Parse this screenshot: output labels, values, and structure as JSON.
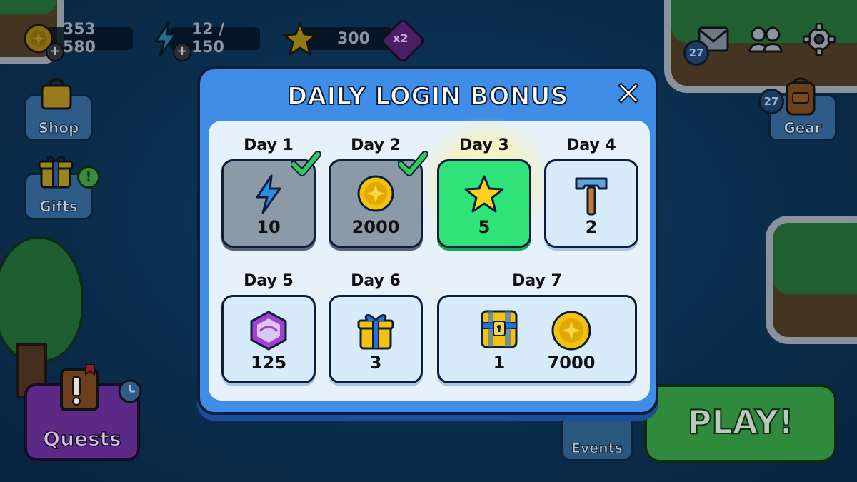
{
  "hud": {
    "coins": "353 580",
    "energy": "12 / 150",
    "stars": "300",
    "multiplier": "x2",
    "mail_count": "27"
  },
  "side": {
    "shop": "Shop",
    "gifts": "Gifts",
    "gear": "Gear",
    "gear_count": "27",
    "quests": "Quests",
    "events": "Events",
    "play": "PLAY!"
  },
  "modal": {
    "title": "DAILY LOGIN BONUS",
    "close": "✕",
    "days": [
      {
        "label": "Day 1",
        "icon": "lightning-icon",
        "amount": "10",
        "state": "claimed"
      },
      {
        "label": "Day 2",
        "icon": "coin-icon",
        "amount": "2000",
        "state": "claimed"
      },
      {
        "label": "Day 3",
        "icon": "star-icon",
        "amount": "5",
        "state": "today"
      },
      {
        "label": "Day 4",
        "icon": "hammer-icon",
        "amount": "2",
        "state": "locked"
      },
      {
        "label": "Day 5",
        "icon": "gem-icon",
        "amount": "125",
        "state": "locked"
      },
      {
        "label": "Day 6",
        "icon": "gift-icon",
        "amount": "3",
        "state": "locked"
      },
      {
        "label": "Day 7",
        "icon": "chest-icon",
        "amount": "1",
        "amount2": "7000",
        "icon2": "coin-icon",
        "state": "locked"
      }
    ]
  },
  "colors": {
    "modal": "#3f8de6",
    "panel": "#e6f1fb",
    "today": "#2fe27a",
    "claimed": "#8c9aa8",
    "check": "#35c95a"
  }
}
